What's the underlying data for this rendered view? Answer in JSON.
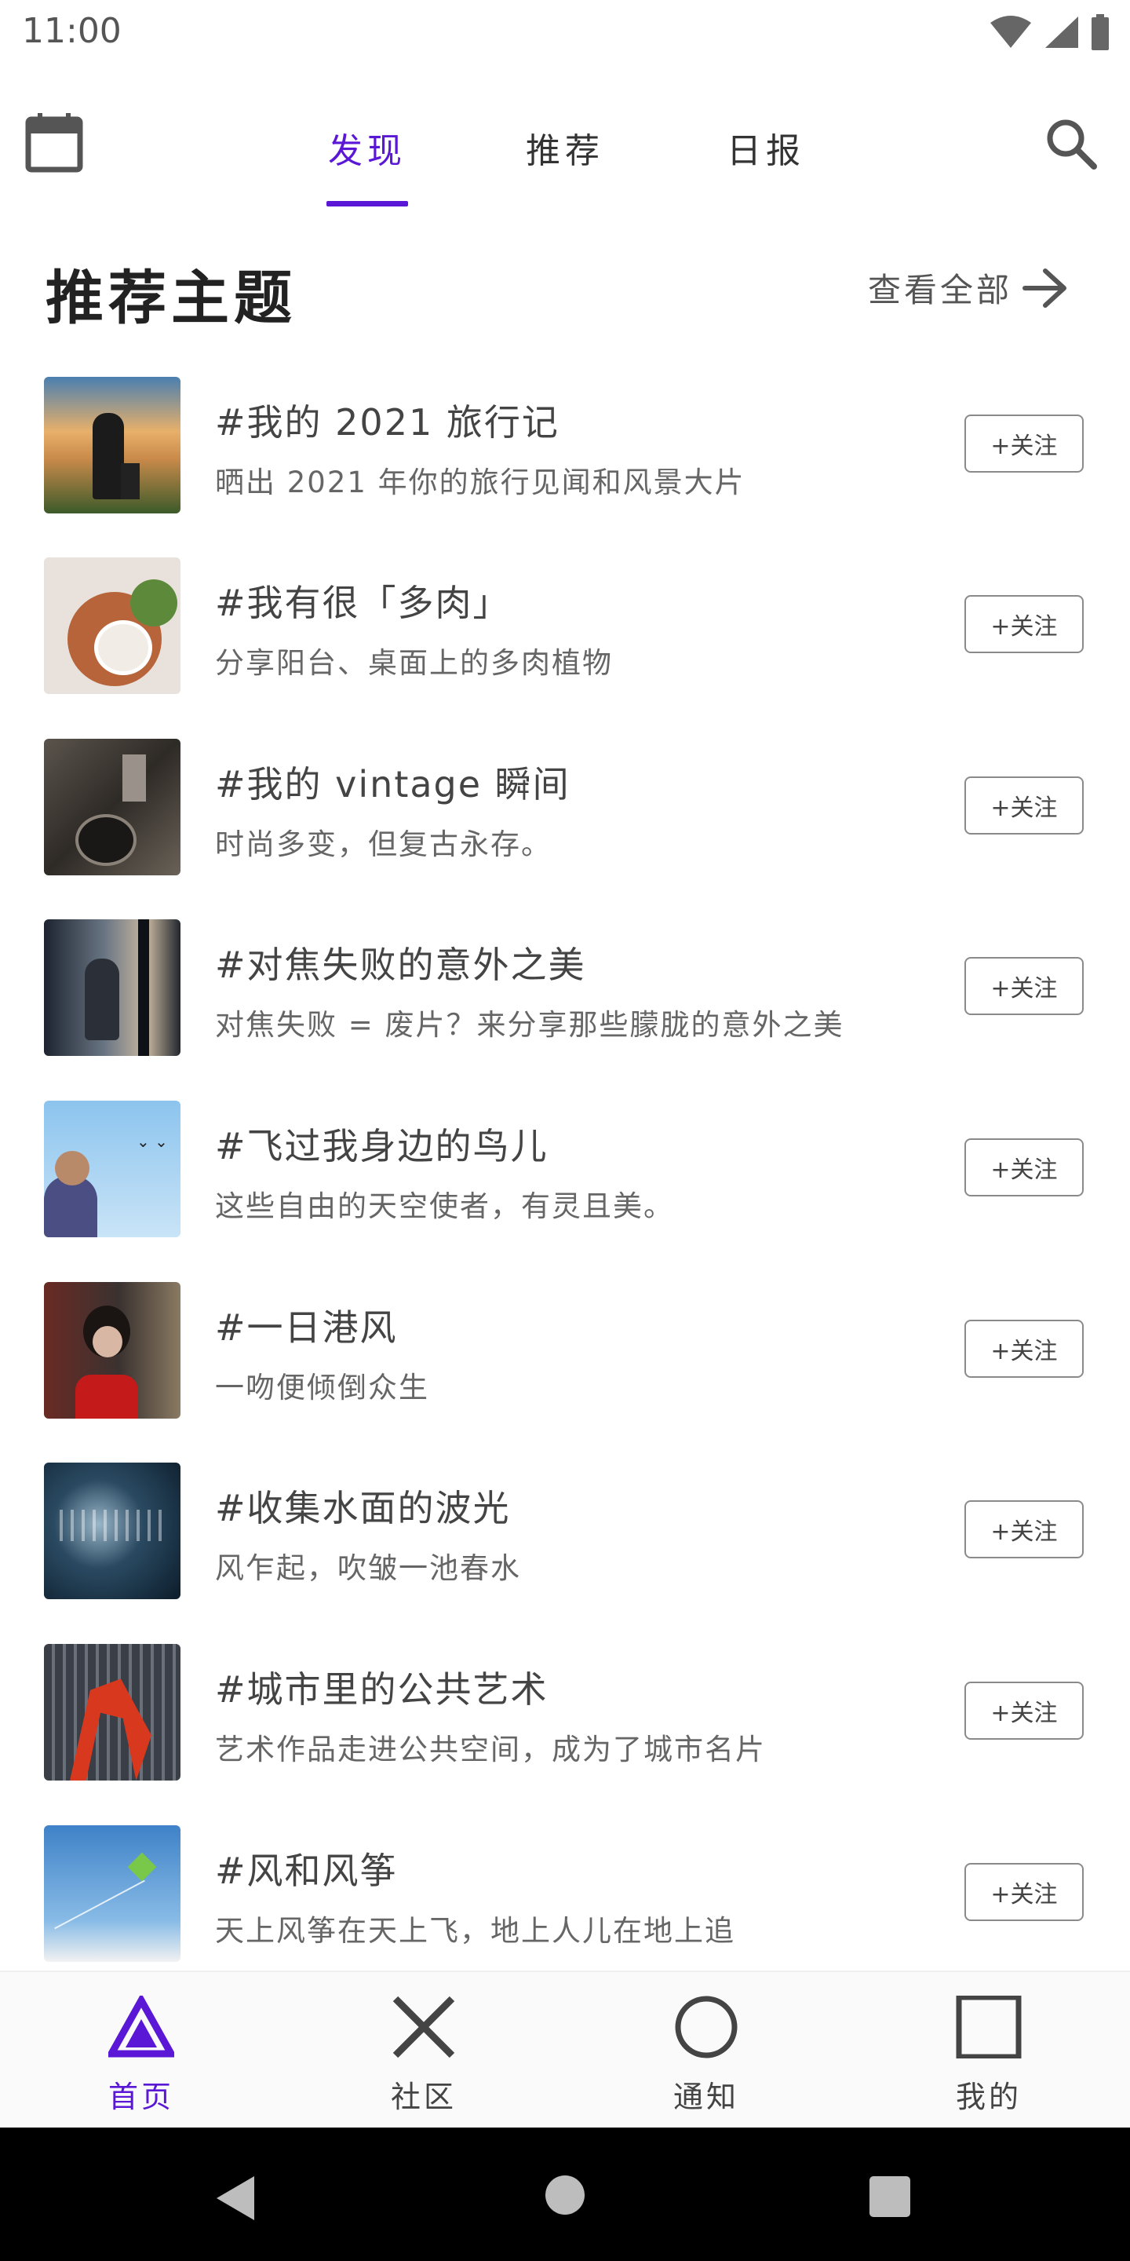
{
  "status_bar": {
    "time": "11:00"
  },
  "top_nav": {
    "tabs": [
      {
        "label": "发现",
        "active": true
      },
      {
        "label": "推荐",
        "active": false
      },
      {
        "label": "日报",
        "active": false
      }
    ],
    "calendar_icon": "calendar-icon",
    "search_icon": "search-icon"
  },
  "section": {
    "title": "推荐主题",
    "view_all_label": "查看全部"
  },
  "follow_label": "+关注",
  "topics": [
    {
      "title": "#我的 2021 旅行记",
      "description": "晒出 2021 年你的旅行见闻和风景大片"
    },
    {
      "title": "#我有很「多肉」",
      "description": "分享阳台、桌面上的多肉植物"
    },
    {
      "title": "#我的 vintage 瞬间",
      "description": "时尚多变，但复古永存。"
    },
    {
      "title": "#对焦失败的意外之美",
      "description": "对焦失败 = 废片？来分享那些朦胧的意外之美"
    },
    {
      "title": "#飞过我身边的鸟儿",
      "description": "这些自由的天空使者，有灵且美。"
    },
    {
      "title": "#一日港风",
      "description": "一吻便倾倒众生"
    },
    {
      "title": "#收集水面的波光",
      "description": "风乍起，吹皱一池春水"
    },
    {
      "title": "#城市里的公共艺术",
      "description": "艺术作品走进公共空间，成为了城市名片"
    },
    {
      "title": "#风和风筝",
      "description": "天上风筝在天上飞，地上人儿在地上追"
    }
  ],
  "bottom_nav": [
    {
      "label": "首页",
      "icon": "triangle-icon",
      "active": true
    },
    {
      "label": "社区",
      "icon": "cross-icon",
      "active": false
    },
    {
      "label": "通知",
      "icon": "circle-icon",
      "active": false
    },
    {
      "label": "我的",
      "icon": "square-icon",
      "active": false
    }
  ],
  "colors": {
    "accent": "#5a17d6",
    "text": "#333333",
    "follow_border": "#8a8a8a"
  }
}
